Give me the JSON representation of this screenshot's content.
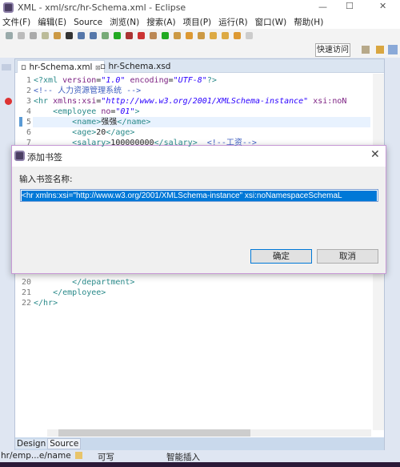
{
  "window": {
    "title": "XML - xml/src/hr-Schema.xml - Eclipse"
  },
  "menu": [
    "文件(F)",
    "编辑(E)",
    "Source",
    "浏览(N)",
    "搜索(A)",
    "项目(P)",
    "运行(R)",
    "窗口(W)",
    "帮助(H)"
  ],
  "toolbar": {
    "quick_access": "快速访问"
  },
  "editor": {
    "tabs": [
      {
        "label": "hr-Schema.xml",
        "active": true
      },
      {
        "label": "hr-Schema.xsd",
        "active": false
      }
    ],
    "lines": [
      {
        "n": "1",
        "html": "<span class='tag'>&lt;?xml </span><span class='attr'>version</span>=<span class='str'>\"1.0\"</span> <span class='attr'>encoding</span>=<span class='str'>\"UTF-8\"</span><span class='tag'>?&gt;</span>"
      },
      {
        "n": "2",
        "html": "<span class='cm'>&lt;!-- 人力资源管理系统 --&gt;</span>"
      },
      {
        "n": "3",
        "html": "<span class='tag'>&lt;hr </span><span class='attr'>xmlns:xsi</span>=<span class='str'>\"http://www.w3.org/2001/XMLSchema-instance\"</span> <span class='attr'>xsi:noN</span>"
      },
      {
        "n": "4",
        "html": "    <span class='tag'>&lt;employee </span><span class='attr'>no</span>=<span class='str'>\"01\"</span><span class='tag'>&gt;</span>"
      },
      {
        "n": "5",
        "html": "        <span class='tag'>&lt;name&gt;</span>强强<span class='tag'>&lt;/name&gt;</span>"
      },
      {
        "n": "6",
        "html": "        <span class='tag'>&lt;age&gt;</span>20<span class='tag'>&lt;/age&gt;</span>"
      },
      {
        "n": "7",
        "html": "        <span class='tag'>&lt;salary&gt;</span>100000000<span class='tag'>&lt;/salary&gt;</span>  <span class='cm'>&lt;!--工资--&gt;</span>"
      }
    ],
    "lines_bottom": [
      {
        "n": "20",
        "html": "        <span class='tag'>&lt;/department&gt;</span>"
      },
      {
        "n": "21",
        "html": "    <span class='tag'>&lt;/employee&gt;</span>"
      },
      {
        "n": "22",
        "html": "<span class='tag'>&lt;/hr&gt;</span>"
      }
    ],
    "bottom_tabs": [
      "Design",
      "Source"
    ]
  },
  "dialog": {
    "title": "添加书签",
    "label": "输入书签名称:",
    "value": "<hr xmlns:xsi=\"http://www.w3.org/2001/XMLSchema-instance\" xsi:noNamespaceSchemaL",
    "ok": "确定",
    "cancel": "取消"
  },
  "status": {
    "path": "hr/emp...e/name",
    "writable": "可写",
    "insert_mode": "智能插入"
  }
}
